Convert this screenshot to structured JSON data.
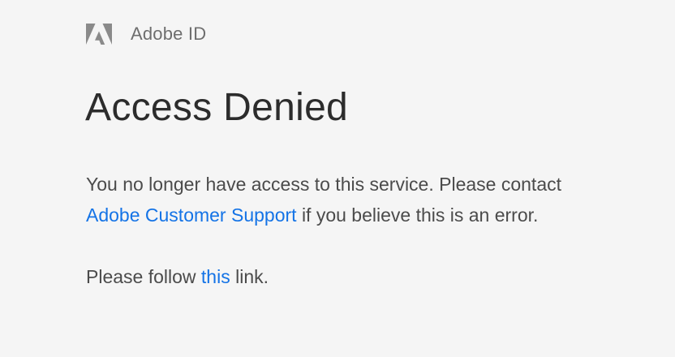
{
  "brand": {
    "name": "Adobe ID",
    "logo_icon": "adobe-logo-icon",
    "logo_color": "#8a8a8a"
  },
  "title": "Access Denied",
  "message": {
    "text_before": "You no longer have access to this service. Please contact",
    "link_text": "Adobe Customer Support",
    "text_after": "if you believe this is an error."
  },
  "follow": {
    "text_before": "Please follow",
    "link_text": "this",
    "text_after": "link."
  },
  "colors": {
    "background": "#f5f5f5",
    "link": "#1473e6",
    "heading": "#2c2c2c",
    "body_text": "#4b4b4b"
  }
}
